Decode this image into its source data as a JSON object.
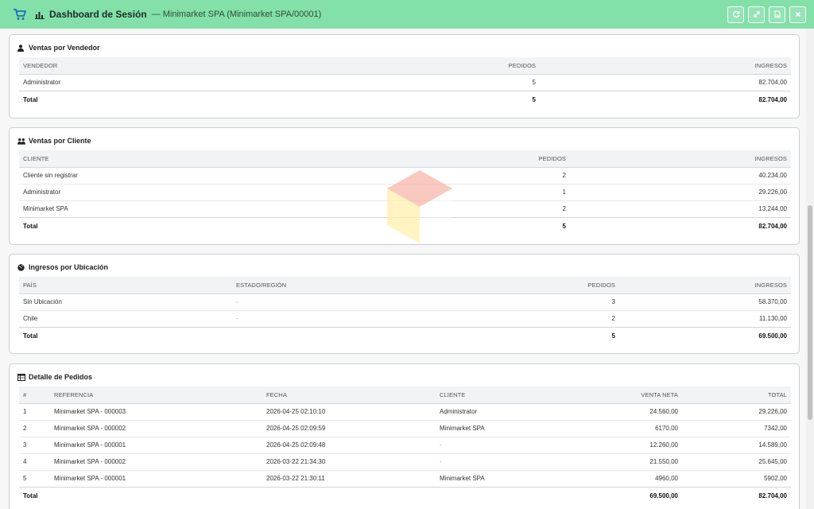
{
  "header": {
    "title": "Dashboard de Sesión",
    "subtitle": "— Minimarket SPA (Minimarket SPA/00001)",
    "colors": {
      "bar": "#82e0a8",
      "accent": "#1f6fb2"
    },
    "actions": [
      "refresh-icon",
      "expand-icon",
      "pdf-icon",
      "close-icon"
    ]
  },
  "vendedor": {
    "title": "Ventas por Vendedor",
    "icon": "user-icon",
    "headers": [
      "VENDEDOR",
      "PEDIDOS",
      "INGRESOS"
    ],
    "rows": [
      [
        "Administrator",
        "5",
        "82.704,00"
      ]
    ],
    "total": [
      "Total",
      "5",
      "82.704,00"
    ]
  },
  "cliente": {
    "title": "Ventas por Cliente",
    "icon": "users-icon",
    "headers": [
      "CLIENTE",
      "PEDIDOS",
      "INGRESOS"
    ],
    "rows": [
      [
        "Cliente sin registrar",
        "2",
        "40.234,00"
      ],
      [
        "Administrator",
        "1",
        "29.226,00"
      ],
      [
        "Minimarket SPA",
        "2",
        "13.244,00"
      ]
    ],
    "total": [
      "Total",
      "5",
      "82.704,00"
    ]
  },
  "ubicacion": {
    "title": "Ingresos por Ubicación",
    "icon": "globe-icon",
    "headers": [
      "PAÍS",
      "ESTADO/REGIÓN",
      "PEDIDOS",
      "INGRESOS"
    ],
    "rows": [
      [
        "Sin Ubicación",
        "-",
        "3",
        "58.370,00"
      ],
      [
        "Chile",
        "-",
        "2",
        "11.130,00"
      ]
    ],
    "total": [
      "Total",
      "",
      "5",
      "69.500,00"
    ]
  },
  "pedidos": {
    "title": "Detalle de Pedidos",
    "icon": "table-icon",
    "headers": [
      "#",
      "REFERENCIA",
      "FECHA",
      "CLIENTE",
      "VENTA NETA",
      "TOTAL"
    ],
    "rows": [
      [
        "1",
        "Minimarket SPA - 000003",
        "2026-04-25 02:10:10",
        "Administrator",
        "24.560,00",
        "29.226,00"
      ],
      [
        "2",
        "Minimarket SPA - 000002",
        "2026-04-25 02:09:59",
        "Minimarket SPA",
        "6170,00",
        "7342,00"
      ],
      [
        "3",
        "Minimarket SPA - 000001",
        "2026-04-25 02:09:48",
        "-",
        "12.260,00",
        "14.589,00"
      ],
      [
        "4",
        "Minimarket SPA - 000002",
        "2026-03-22 21:34:30",
        "-",
        "21.550,00",
        "25.645,00"
      ],
      [
        "5",
        "Minimarket SPA - 000001",
        "2026-03-22 21:30:11",
        "Minimarket SPA",
        "4960,00",
        "5902,00"
      ]
    ],
    "total": [
      "Total",
      "",
      "",
      "",
      "69.500,00",
      "82.704,00"
    ]
  }
}
